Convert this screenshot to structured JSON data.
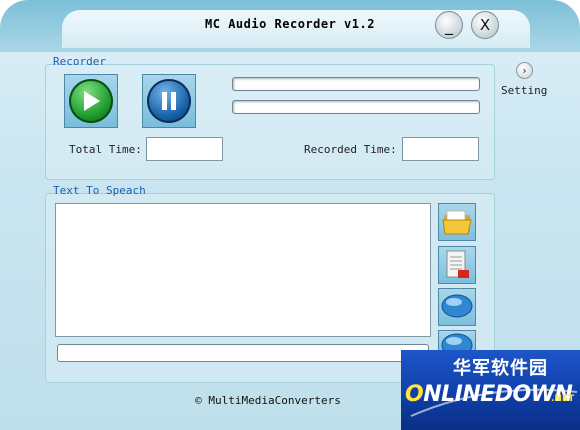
{
  "window": {
    "title": "MC Audio Recorder v1.2",
    "minimize_label": "_",
    "close_label": "X"
  },
  "recorder": {
    "panel_title": "Recorder",
    "play_icon": "play-icon",
    "pause_icon": "pause-icon",
    "total_time_label": "Total Time:",
    "total_time_value": "",
    "recorded_time_label": "Recorded Time:",
    "recorded_time_value": ""
  },
  "setting": {
    "label": "Setting",
    "icon_glyph": "›"
  },
  "tts": {
    "panel_title": "Text To Speach",
    "text_value": "",
    "input_value": "",
    "buttons": [
      "open-folder-icon",
      "document-icon",
      "speak-bubble-icon",
      "speak-bubble-icon"
    ]
  },
  "footer": {
    "copyright": "© MultiMediaConverters"
  },
  "watermark": {
    "cn_text": "华军软件园",
    "en_first": "O",
    "en_rest": "NLINEDOWN",
    "net": ".NET"
  },
  "colors": {
    "panel_title": "#1e5fb0",
    "window_bg": "#c9e5f0",
    "play_green": "#1e9a2e",
    "pause_blue": "#1662a8",
    "watermark_blue": "#1e56c8",
    "watermark_yellow": "#ffe23a"
  }
}
